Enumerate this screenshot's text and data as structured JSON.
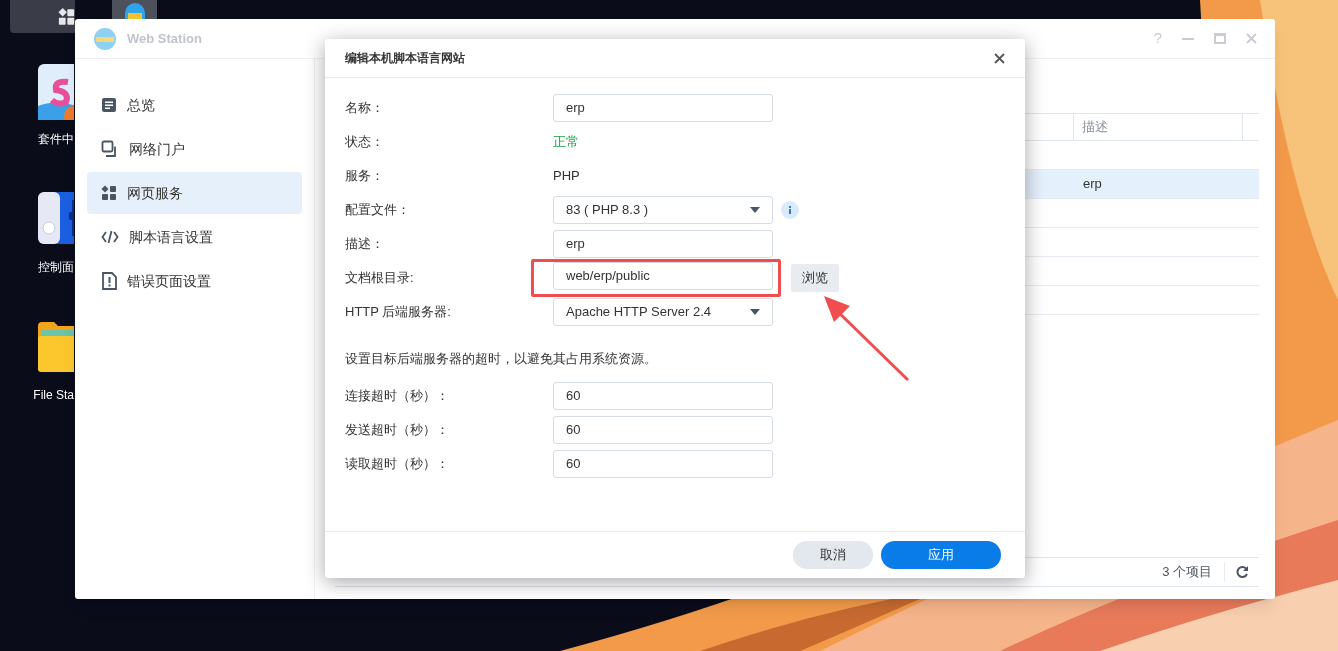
{
  "desktop_icons": [
    {
      "kind": "package",
      "label": "套件中"
    },
    {
      "kind": "control",
      "label": "控制面"
    },
    {
      "kind": "folder",
      "label": "File Sta"
    }
  ],
  "window": {
    "title": "Web Station",
    "help": "?",
    "sidebar": [
      {
        "kind": "overview",
        "label": "总览",
        "selected": false
      },
      {
        "kind": "portal",
        "label": "网络门户",
        "selected": false
      },
      {
        "kind": "service",
        "label": "网页服务",
        "selected": true
      },
      {
        "kind": "script",
        "label": "脚本语言设置",
        "selected": false
      },
      {
        "kind": "error",
        "label": "错误页面设置",
        "selected": false
      }
    ],
    "table": {
      "columns": [
        "描述"
      ],
      "rows": [
        {
          "selected": false
        },
        {
          "description": "erp",
          "selected": true
        },
        {
          "selected": false
        }
      ]
    },
    "status_bar": {
      "count": "3 个项目"
    }
  },
  "dialog": {
    "title": "编辑本机脚本语言网站",
    "fields": [
      {
        "kind": "input",
        "label": "名称：",
        "value": "erp"
      },
      {
        "kind": "status",
        "label": "状态：",
        "value": "正常"
      },
      {
        "kind": "plain",
        "label": "服务：",
        "value": "PHP"
      },
      {
        "kind": "select",
        "label": "配置文件：",
        "value": "83 ( PHP 8.3 )",
        "info": true
      },
      {
        "kind": "input",
        "label": "描述：",
        "value": "erp"
      },
      {
        "kind": "browse",
        "label": "文档根目录:",
        "value": "web/erp/public",
        "button": "浏览"
      },
      {
        "kind": "select",
        "label": "HTTP 后端服务器:",
        "value": "Apache HTTP Server 2.4"
      }
    ],
    "note": "设置目标后端服务器的超时，以避免其占用系统资源。",
    "timeouts": [
      {
        "kind": "input",
        "label": "连接超时（秒）：",
        "value": "60"
      },
      {
        "kind": "input",
        "label": "发送超时（秒）：",
        "value": "60"
      },
      {
        "kind": "input",
        "label": "读取超时（秒）：",
        "value": "60"
      }
    ],
    "buttons": [
      {
        "label": "取消",
        "kind": "secondary"
      },
      {
        "label": "应用",
        "kind": "primary"
      }
    ]
  }
}
